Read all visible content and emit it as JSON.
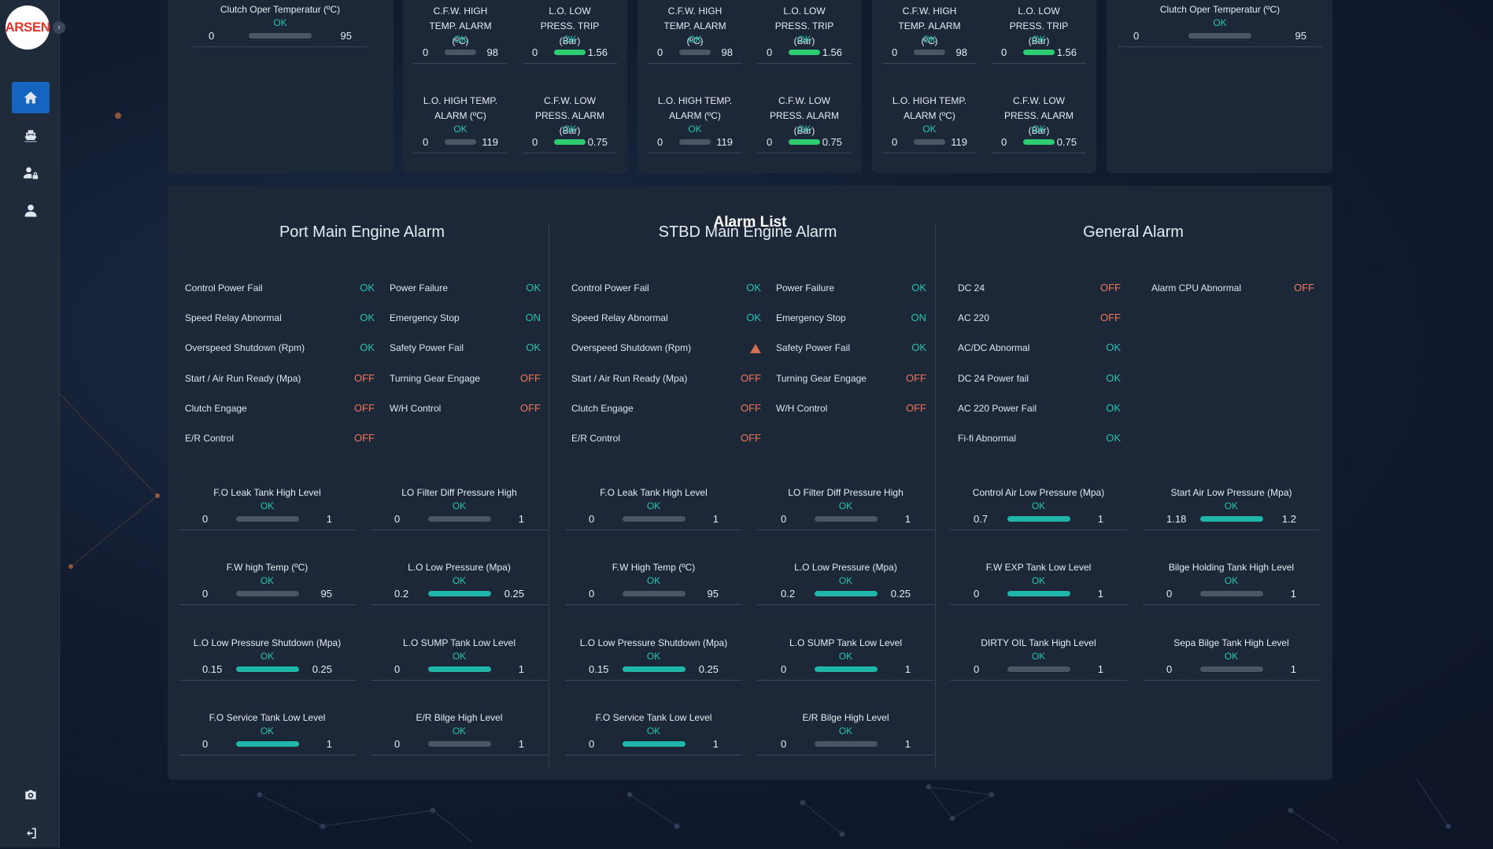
{
  "app": {
    "logo_text": "ARSEN"
  },
  "colors": {
    "accent": "#1565c0",
    "ok": "#27c3b5",
    "off": "#f0765a",
    "bar_green": "#2ecc71",
    "bar_teal": "#1fb5a8",
    "bar_gray": "#4a5566"
  },
  "sidebar": {
    "items": [
      {
        "icon": "home-icon"
      },
      {
        "icon": "ship-icon"
      },
      {
        "icon": "user-lock-icon"
      },
      {
        "icon": "user-icon"
      }
    ],
    "bottom": [
      {
        "icon": "camera-icon"
      },
      {
        "icon": "logout-icon"
      }
    ]
  },
  "top": {
    "clutch_left": {
      "title": "Clutch Oper Temperatur (ºC)",
      "status": "OK",
      "min": "0",
      "max": "95",
      "level": 0
    },
    "clutch_right": {
      "title": "Clutch Oper Temperatur (ºC)",
      "status": "OK",
      "min": "0",
      "max": "95",
      "level": 0
    },
    "groups": [
      {
        "cfw_high_title": "C.F.W. HIGH TEMP. ALARM (ºC)",
        "cfw_high": {
          "status": "OK",
          "min": "0",
          "max": "98",
          "level": 0
        },
        "lo_low_trip_title": "L.O. LOW PRESS. TRIP (Bar)",
        "lo_low_trip": {
          "status": "OK",
          "min": "0",
          "max": "1.56",
          "level": 1
        },
        "lo_high_title": "L.O. HIGH TEMP. ALARM (ºC)",
        "lo_high": {
          "status": "OK",
          "min": "0",
          "max": "119",
          "level": 0
        },
        "cfw_low_title": "C.F.W. LOW PRESS. ALARM (Bar)",
        "cfw_low": {
          "status": "OK",
          "min": "0",
          "max": "0.75",
          "level": 1
        }
      },
      {
        "cfw_high_title": "C.F.W. HIGH TEMP. ALARM (ºC)",
        "cfw_high": {
          "status": "OK",
          "min": "0",
          "max": "98",
          "level": 0
        },
        "lo_low_trip_title": "L.O. LOW PRESS. TRIP (Bar)",
        "lo_low_trip": {
          "status": "OK",
          "min": "0",
          "max": "1.56",
          "level": 1
        },
        "lo_high_title": "L.O. HIGH TEMP. ALARM (ºC)",
        "lo_high": {
          "status": "OK",
          "min": "0",
          "max": "119",
          "level": 0
        },
        "cfw_low_title": "C.F.W. LOW PRESS. ALARM (Bar)",
        "cfw_low": {
          "status": "OK",
          "min": "0",
          "max": "0.75",
          "level": 1
        }
      },
      {
        "cfw_high_title": "C.F.W. HIGH TEMP. ALARM (ºC)",
        "cfw_high": {
          "status": "OK",
          "min": "0",
          "max": "98",
          "level": 0
        },
        "lo_low_trip_title": "L.O. LOW PRESS. TRIP (Bar)",
        "lo_low_trip": {
          "status": "OK",
          "min": "0",
          "max": "1.56",
          "level": 1
        },
        "lo_high_title": "L.O. HIGH TEMP. ALARM (ºC)",
        "lo_high": {
          "status": "OK",
          "min": "0",
          "max": "119",
          "level": 0
        },
        "cfw_low_title": "C.F.W. LOW PRESS. ALARM (Bar)",
        "cfw_low": {
          "status": "OK",
          "min": "0",
          "max": "0.75",
          "level": 1
        }
      }
    ]
  },
  "alarm_list": {
    "title": "Alarm List",
    "port": {
      "title": "Port Main Engine Alarm",
      "left": [
        {
          "label": "Control Power Fail",
          "value": "OK"
        },
        {
          "label": "Speed Relay Abnormal",
          "value": "OK"
        },
        {
          "label": "Overspeed Shutdown (Rpm)",
          "value": "OK"
        },
        {
          "label": "Start / Air Run Ready (Mpa)",
          "value": "OFF"
        },
        {
          "label": "Clutch Engage",
          "value": "OFF"
        },
        {
          "label": "E/R Control",
          "value": "OFF"
        }
      ],
      "right": [
        {
          "label": "Power Failure",
          "value": "OK"
        },
        {
          "label": "Emergency Stop",
          "value": "ON"
        },
        {
          "label": "Safety Power Fail",
          "value": "OK"
        },
        {
          "label": "Turning Gear Engage",
          "value": "OFF"
        },
        {
          "label": "W/H Control",
          "value": "OFF"
        }
      ],
      "gauges": [
        {
          "title": "F.O Leak Tank High Level",
          "status": "OK",
          "min": "0",
          "max": "1",
          "level": 0
        },
        {
          "title": "LO Filter Diff Pressure High",
          "status": "OK",
          "min": "0",
          "max": "1",
          "level": 0
        },
        {
          "title": "F.W high Temp (ºC)",
          "status": "OK",
          "min": "0",
          "max": "95",
          "level": 0
        },
        {
          "title": "L.O Low Pressure (Mpa)",
          "status": "OK",
          "min": "0.2",
          "max": "0.25",
          "level": 1
        },
        {
          "title": "L.O Low Pressure Shutdown (Mpa)",
          "status": "OK",
          "min": "0.15",
          "max": "0.25",
          "level": 1
        },
        {
          "title": "L.O SUMP Tank Low Level",
          "status": "OK",
          "min": "0",
          "max": "1",
          "level": 1
        },
        {
          "title": "F.O Service Tank Low Level",
          "status": "OK",
          "min": "0",
          "max": "1",
          "level": 1
        },
        {
          "title": "E/R Bilge High Level",
          "status": "OK",
          "min": "0",
          "max": "1",
          "level": 0
        }
      ]
    },
    "stbd": {
      "title": "STBD Main Engine Alarm",
      "left": [
        {
          "label": "Control Power Fail",
          "value": "OK"
        },
        {
          "label": "Speed Relay Abnormal",
          "value": "OK"
        },
        {
          "label": "Overspeed Shutdown (Rpm)",
          "value": "",
          "warning": true
        },
        {
          "label": "Start / Air Run Ready (Mpa)",
          "value": "OFF"
        },
        {
          "label": "Clutch Engage",
          "value": "OFF"
        },
        {
          "label": "E/R Control",
          "value": "OFF"
        }
      ],
      "right": [
        {
          "label": "Power Failure",
          "value": "OK"
        },
        {
          "label": "Emergency Stop",
          "value": "ON"
        },
        {
          "label": "Safety Power Fail",
          "value": "OK"
        },
        {
          "label": "Turning Gear Engage",
          "value": "OFF"
        },
        {
          "label": "W/H Control",
          "value": "OFF"
        }
      ],
      "gauges": [
        {
          "title": "F.O Leak Tank High Level",
          "status": "OK",
          "min": "0",
          "max": "1",
          "level": 0
        },
        {
          "title": "LO Filter Diff Pressure High",
          "status": "OK",
          "min": "0",
          "max": "1",
          "level": 0
        },
        {
          "title": "F.W High Temp (ºC)",
          "status": "OK",
          "min": "0",
          "max": "95",
          "level": 0
        },
        {
          "title": "L.O Low Pressure (Mpa)",
          "status": "OK",
          "min": "0.2",
          "max": "0.25",
          "level": 1
        },
        {
          "title": "L.O Low Pressure Shutdown (Mpa)",
          "status": "OK",
          "min": "0.15",
          "max": "0.25",
          "level": 1
        },
        {
          "title": "L.O SUMP Tank Low Level",
          "status": "OK",
          "min": "0",
          "max": "1",
          "level": 1
        },
        {
          "title": "F.O Service Tank Low Level",
          "status": "OK",
          "min": "0",
          "max": "1",
          "level": 1
        },
        {
          "title": "E/R Bilge High Level",
          "status": "OK",
          "min": "0",
          "max": "1",
          "level": 0
        }
      ]
    },
    "general": {
      "title": "General Alarm",
      "left": [
        {
          "label": "DC 24",
          "value": "OFF"
        },
        {
          "label": "AC 220",
          "value": "OFF"
        },
        {
          "label": "AC/DC Abnormal",
          "value": "OK"
        },
        {
          "label": "DC 24 Power fail",
          "value": "OK"
        },
        {
          "label": "AC 220 Power Fail",
          "value": "OK"
        },
        {
          "label": "Fi-fi Abnormal",
          "value": "OK"
        }
      ],
      "right": [
        {
          "label": "Alarm CPU Abnormal",
          "value": "OFF"
        }
      ],
      "gauges": [
        {
          "title": "Control Air Low Pressure (Mpa)",
          "status": "OK",
          "min": "0.7",
          "max": "1",
          "level": 1
        },
        {
          "title": "Start Air Low Pressure (Mpa)",
          "status": "OK",
          "min": "1.18",
          "max": "1.2",
          "level": 1
        },
        {
          "title": "F.W EXP Tank Low Level",
          "status": "OK",
          "min": "0",
          "max": "1",
          "level": 1
        },
        {
          "title": "Bilge Holding Tank High Level",
          "status": "OK",
          "min": "0",
          "max": "1",
          "level": 0
        },
        {
          "title": "DIRTY OIL Tank High Level",
          "status": "OK",
          "min": "0",
          "max": "1",
          "level": 0
        },
        {
          "title": "Sepa Bilge Tank High Level",
          "status": "OK",
          "min": "0",
          "max": "1",
          "level": 0
        }
      ]
    }
  }
}
